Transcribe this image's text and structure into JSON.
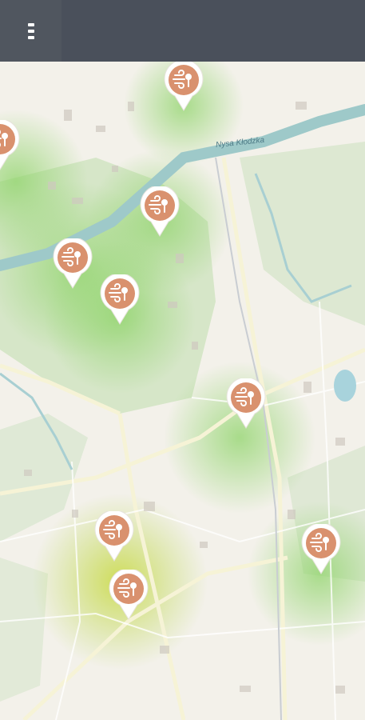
{
  "header": {
    "menu_icon": "hamburger-menu-icon",
    "bg_color": "#4a505b"
  },
  "map": {
    "river_label": "Nysa Kłodzka",
    "marker_color": "#d9916e",
    "marker_icon": "wind-pollution-icon",
    "heat_colors": {
      "low": "#8fd46a",
      "mid": "#c9d93e"
    },
    "markers": [
      {
        "id": "m1"
      },
      {
        "id": "m2"
      },
      {
        "id": "m3"
      },
      {
        "id": "m4"
      },
      {
        "id": "m5"
      },
      {
        "id": "m6"
      },
      {
        "id": "m7"
      },
      {
        "id": "m8"
      },
      {
        "id": "m9"
      },
      {
        "id": "m10"
      }
    ]
  }
}
